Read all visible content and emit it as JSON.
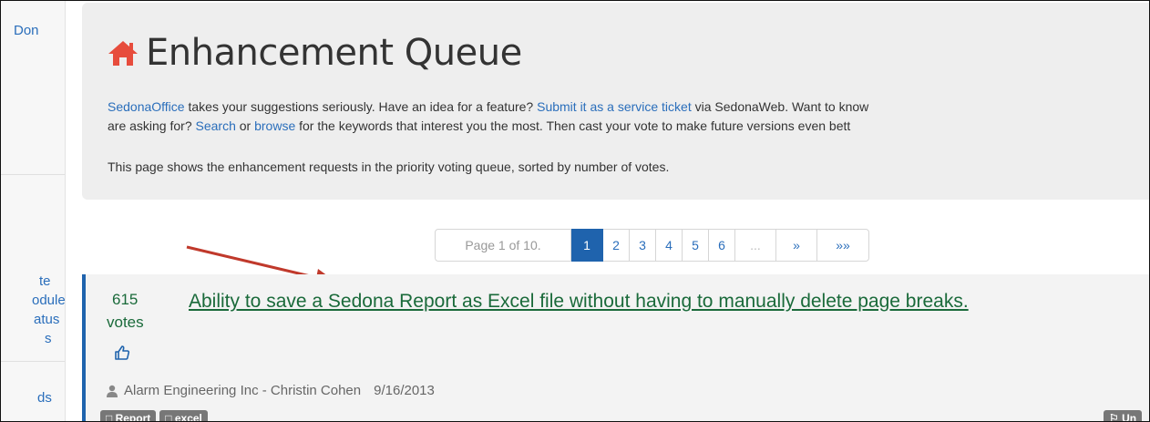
{
  "sidebar": {
    "user": "Don",
    "items": [
      "te",
      "odule",
      "atus",
      "s",
      "ds"
    ]
  },
  "header": {
    "title": "Enhancement Queue",
    "icon": "home-icon"
  },
  "intro": {
    "link_sedona": "SedonaOffice",
    "t1": " takes your suggestions seriously. Have an idea for a feature? ",
    "link_submit": "Submit it as a service ticket",
    "t2": " via SedonaWeb. Want to know",
    "t3": "are asking for? ",
    "link_search": "Search",
    "t4": " or ",
    "link_browse": "browse",
    "t5": " for the keywords that interest you the most. Then cast your vote to make future versions even bett"
  },
  "note": "This page shows the enhancement requests in the priority voting queue, sorted by number of votes.",
  "pagination": {
    "info": "Page 1 of 10.",
    "pages": [
      "1",
      "2",
      "3",
      "4",
      "5",
      "6"
    ],
    "current": 1,
    "ellipsis": "...",
    "next": "»",
    "last": "»»"
  },
  "item": {
    "votes": "615",
    "votes_label": "votes",
    "title": "Ability to save a Sedona Report as Excel file without having to manually delete page breaks.",
    "author": "Alarm Engineering Inc - Christin Cohen",
    "date": "9/16/2013",
    "tags": [
      "Report",
      "excel"
    ],
    "right_tag": "Un"
  },
  "colors": {
    "accent": "#1f63ad",
    "link": "#2a6ebb",
    "item_title": "#1a6a3a",
    "home_icon": "#e74c3c",
    "arrow": "#c0392b"
  }
}
